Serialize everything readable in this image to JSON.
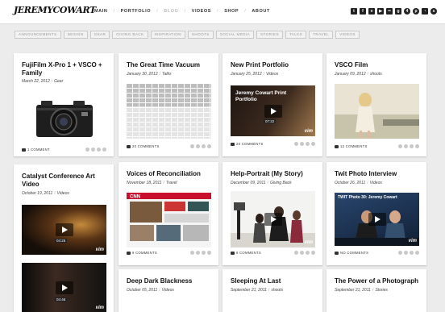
{
  "site": {
    "logo": "JEREMYCOWART"
  },
  "nav": {
    "items": [
      "MAIN",
      "PORTFOLIO",
      "BLOG",
      "VIDEOS",
      "SHOP",
      "ABOUT"
    ]
  },
  "social_icons": [
    "twitter-icon",
    "facebook-icon",
    "vimeo-icon",
    "youtube-icon",
    "flickr-icon",
    "google-plus-icon",
    "foursquare-icon",
    "pinterest-icon",
    "rss-icon",
    "skype-icon"
  ],
  "categories": [
    "ANNOUNCEMENTS",
    "DESIGN",
    "GEAR",
    "GIVING BACK",
    "INSPIRATION",
    "SHOOTS",
    "SOCIAL MEDIA",
    "STORIES",
    "TALKS",
    "TRAVEL",
    "VIDEOS"
  ],
  "posts": [
    {
      "title": "FujiFilm X-Pro 1 + VSCO + Family",
      "date": "March 22, 2012",
      "category": "Gear",
      "comments": "1 COMMENT"
    },
    {
      "title": "The Great Time Vacuum",
      "date": "January 30, 2012",
      "category": "Talks",
      "comments": "20 COMMENTS"
    },
    {
      "title": "New Print Portfolio",
      "date": "January 25, 2012",
      "category": "Videos",
      "comments": "20 COMMENTS",
      "video_title": "Jeremy Cowart Print Portfolio",
      "video_time": "07:22"
    },
    {
      "title": "VSCO Film",
      "date": "January 09, 2012",
      "category": "shoots",
      "comments": "12 COMMENTS"
    },
    {
      "title": "Catalyst Conference Art Video",
      "date": "October 19, 2011",
      "category": "Videos",
      "video_time": "04:25",
      "video_time_2": "04:46"
    },
    {
      "title": "Voices of Reconciliation",
      "date": "November 18, 2011",
      "category": "Travel",
      "comments": "9 COMMENTS"
    },
    {
      "title": "Help-Portrait (My Story)",
      "date": "December 09, 2011",
      "category": "Giving Back",
      "comments": "6 COMMENTS"
    },
    {
      "title": "Twit Photo Interview",
      "date": "October 26, 2011",
      "category": "Videos",
      "comments": "NO COMMENTS",
      "video_title": "TWIT Photo 30: Jeremy Cowart"
    },
    {
      "title": "Deep Dark Blackness",
      "date": "October 05, 2011",
      "category": "Videos"
    },
    {
      "title": "Sleeping At Last",
      "date": "September 21, 2011",
      "category": "shoots"
    },
    {
      "title": "The Power of a Photograph",
      "date": "September 21, 2011",
      "category": "Stories"
    }
  ],
  "colors": {
    "background": "#ececec",
    "card": "#ffffff",
    "text": "#111111",
    "muted": "#999999"
  }
}
